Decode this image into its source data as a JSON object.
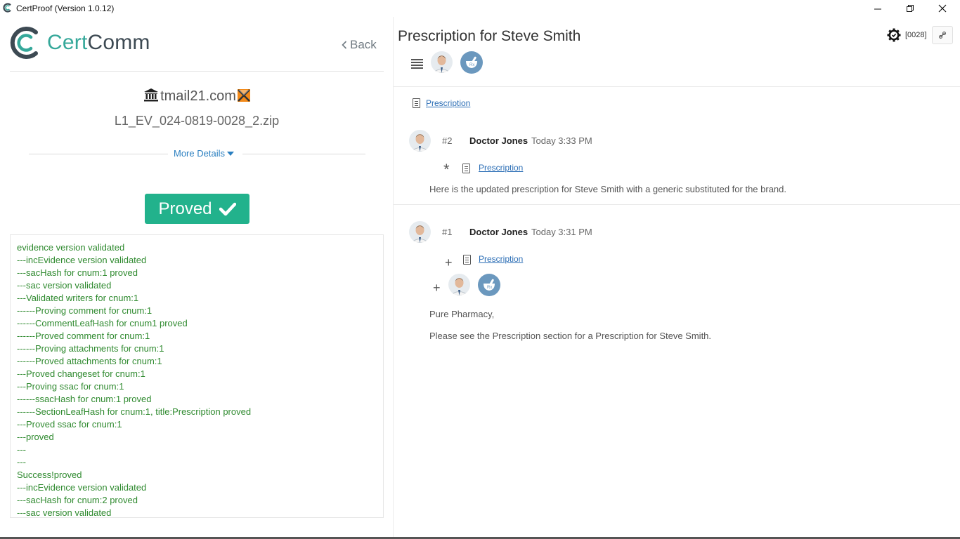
{
  "window": {
    "title": "CertProof (Version 1.0.12)",
    "controls": [
      "minimize",
      "maximize",
      "close"
    ]
  },
  "left": {
    "brand": {
      "part1": "Cert",
      "part2": "Comm"
    },
    "back_label": "Back",
    "domain": "tmail21.com",
    "filename": "L1_EV_024-0819-0028_2.zip",
    "more_details": "More Details",
    "status_label": "Proved",
    "status_color": "#22b28c",
    "log": [
      "evidence version validated",
      "---incEvidence version validated",
      "---sacHash for cnum:1 proved",
      "---sac version validated",
      "---Validated writers for cnum:1",
      "------Proving comment for cnum:1",
      "------CommentLeafHash for cnum1 proved",
      "------Proved comment for cnum:1",
      "------Proving attachments for cnum:1",
      "------Proved attachments for cnum:1",
      "---Proved changeset for cnum:1",
      "---Proving ssac for cnum:1",
      "------ssacHash for cnum:1 proved",
      "------SectionLeafHash for cnum:1, title:Prescription proved",
      "---Proved ssac for cnum:1",
      "---proved",
      "---",
      "---",
      "Success!proved",
      "---incEvidence version validated",
      "---sacHash for cnum:2 proved",
      "---sac version validated"
    ]
  },
  "right": {
    "title": "Prescription for Steve Smith",
    "cnum": "[0028]",
    "section_link": "Prescription",
    "entries": [
      {
        "num": "#2",
        "author": "Doctor Jones",
        "time": "Today 3:33 PM",
        "change_symbol": "*",
        "attachment": "Prescription",
        "text": "Here is the updated prescription for Steve Smith with a generic substituted for the brand."
      },
      {
        "num": "#1",
        "author": "Doctor Jones",
        "time": "Today 3:31 PM",
        "change_symbol": "+",
        "attachment": "Prescription",
        "text1": "Pure Pharmacy,",
        "text2": "Please see the Prescription section for a Prescription for Steve Smith."
      }
    ]
  }
}
